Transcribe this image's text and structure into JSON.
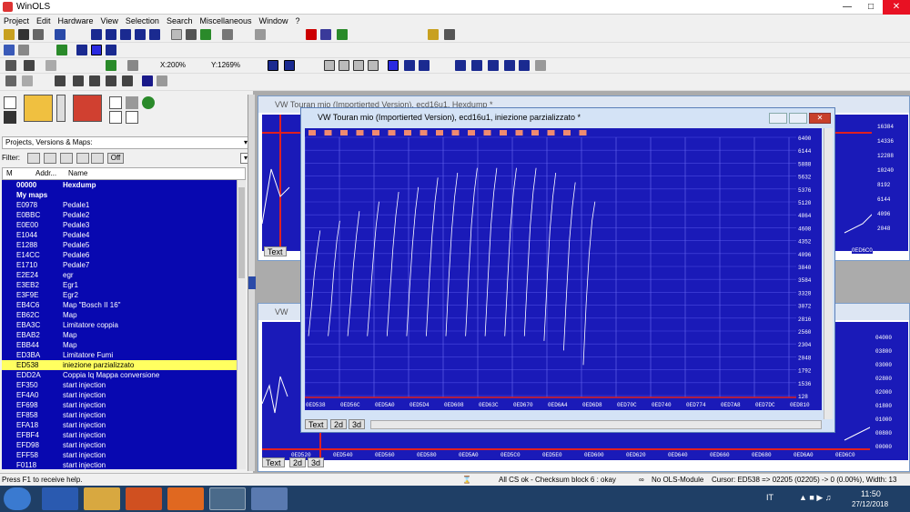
{
  "app": {
    "title": "WinOLS"
  },
  "menu": [
    "Project",
    "Edit",
    "Hardware",
    "View",
    "Selection",
    "Search",
    "Miscellaneous",
    "Window",
    "?"
  ],
  "toolbar": {
    "zoom_x": "X:200%",
    "zoom_y": "Y:1269%"
  },
  "panel": {
    "selector": "Projects, Versions & Maps:",
    "filter_label": "Filter:",
    "filter_toggle": "Off",
    "col_m": "M",
    "col_addr": "Addr...",
    "col_name": "Name"
  },
  "maps": [
    {
      "addr": "00000",
      "name": "Hexdump",
      "style": "hdr"
    },
    {
      "addr": "My maps",
      "name": "",
      "style": "hdr"
    },
    {
      "addr": "E0978",
      "name": "Pedale1"
    },
    {
      "addr": "E0BBC",
      "name": "Pedale2"
    },
    {
      "addr": "E0E00",
      "name": "Pedale3"
    },
    {
      "addr": "E1044",
      "name": "Pedale4"
    },
    {
      "addr": "E1288",
      "name": "Pedale5"
    },
    {
      "addr": "E14CC",
      "name": "Pedale6"
    },
    {
      "addr": "E1710",
      "name": "Pedale7"
    },
    {
      "addr": "E2E24",
      "name": "egr"
    },
    {
      "addr": "E3EB2",
      "name": "Egr1"
    },
    {
      "addr": "E3F9E",
      "name": "Egr2"
    },
    {
      "addr": "EB4C6",
      "name": "Map \"Bosch II 16\""
    },
    {
      "addr": "EB62C",
      "name": "Map"
    },
    {
      "addr": "EBA3C",
      "name": "Limitatore coppia"
    },
    {
      "addr": "EBAB2",
      "name": "Map"
    },
    {
      "addr": "EBB44",
      "name": "Map"
    },
    {
      "addr": "ED3BA",
      "name": "Limitatore Fumi"
    },
    {
      "addr": "ED538",
      "name": "iniezione parzializzato",
      "style": "sel"
    },
    {
      "addr": "EDD2A",
      "name": "Coppia Iq Mappa conversione"
    },
    {
      "addr": "EF350",
      "name": "start injection"
    },
    {
      "addr": "EF4A0",
      "name": "start injection"
    },
    {
      "addr": "EF698",
      "name": "start injection"
    },
    {
      "addr": "EF858",
      "name": "start injection"
    },
    {
      "addr": "EFA18",
      "name": "start injection"
    },
    {
      "addr": "EFBF4",
      "name": "start injection"
    },
    {
      "addr": "EFD98",
      "name": "start injection"
    },
    {
      "addr": "EFF58",
      "name": "start injection"
    },
    {
      "addr": "F0118",
      "name": "start injection"
    }
  ],
  "bg_windows": {
    "top_title": "VW Touran mio (Importierted Version), ecd16u1, Hexdump *",
    "bottom_title": "VW",
    "top_right_ticks": [
      "16384",
      "14336",
      "12288",
      "10240",
      "8192",
      "6144",
      "4096",
      "2048"
    ],
    "bottom_right_ticks": [
      "04000",
      "03800",
      "03000",
      "02800",
      "02000",
      "01800",
      "01000",
      "00800",
      "00000"
    ],
    "bottom_x_ticks": [
      "0ED520",
      "0ED540",
      "0ED560",
      "0ED580",
      "0ED5A0",
      "0ED5C0",
      "0ED5E0",
      "0ED600",
      "0ED620",
      "0ED640",
      "0ED660",
      "0ED680",
      "0ED6A0",
      "0ED6C0"
    ],
    "top_addr": "0ED6C0"
  },
  "fg_window": {
    "title": "VW Touran mio (Importierted Version), ecd16u1, iniezione parzializzato *"
  },
  "tabs": {
    "text": "Text",
    "d2": "2d",
    "d3": "3d"
  },
  "chart_data": {
    "type": "line",
    "title": "",
    "y_ticks": [
      "6400",
      "6144",
      "5888",
      "5632",
      "5376",
      "5120",
      "4864",
      "4608",
      "4352",
      "4096",
      "3840",
      "3584",
      "3328",
      "3072",
      "2816",
      "2560",
      "2304",
      "2048",
      "1792",
      "1536",
      "128"
    ],
    "x_ticks": [
      "0ED538",
      "0ED56C",
      "0ED5A0",
      "0ED5D4",
      "0ED608",
      "0ED63C",
      "0ED670",
      "0ED6A4",
      "0ED6D8",
      "0ED70C",
      "0ED740",
      "0ED774",
      "0ED7A8",
      "0ED7DC",
      "0ED810"
    ],
    "ylim": [
      1024,
      6400
    ],
    "series": [
      {
        "values": [
          2300,
          2900,
          3600,
          4100,
          4500
        ]
      },
      {
        "values": [
          2300,
          2900,
          3700,
          4300,
          4700
        ]
      },
      {
        "values": [
          2300,
          3000,
          3800,
          4400,
          4900
        ]
      },
      {
        "values": [
          2300,
          3100,
          3900,
          4600,
          5100
        ]
      },
      {
        "values": [
          2300,
          3200,
          4100,
          4800,
          5300
        ]
      },
      {
        "values": [
          2300,
          3300,
          4200,
          4900,
          5400
        ]
      },
      {
        "values": [
          2300,
          3400,
          4400,
          5100,
          5600
        ]
      },
      {
        "values": [
          2300,
          3500,
          4500,
          5200,
          5700
        ]
      },
      {
        "values": [
          2300,
          3500,
          4600,
          5300,
          5800
        ]
      },
      {
        "values": [
          2300,
          3500,
          4600,
          5300,
          5800
        ]
      },
      {
        "values": [
          2300,
          3500,
          4600,
          5300,
          5800
        ]
      },
      {
        "values": [
          2300,
          3500,
          4600,
          5300,
          5800
        ]
      },
      {
        "values": [
          2200,
          3400,
          4500,
          5200,
          5700
        ]
      },
      {
        "values": [
          2000,
          3200,
          4300,
          5000,
          5500
        ]
      },
      {
        "values": [
          1700,
          3000,
          4000,
          4700,
          5100
        ]
      }
    ]
  },
  "status": {
    "help": "Press F1 to receive help.",
    "cs": "All CS ok - Checksum block 6 : okay",
    "module": "No OLS-Module",
    "cursor": "Cursor: ED538 => 02205 (02205) -> 0 (0.00%), Width: 13"
  },
  "taskbar": {
    "lang": "IT",
    "time": "11:50",
    "date": "27/12/2018"
  }
}
